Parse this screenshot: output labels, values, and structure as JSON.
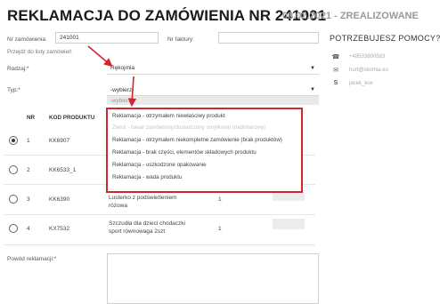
{
  "header": {
    "title": "REKLAMACJA DO ZAMÓWIENIA NR 241001",
    "meta": "08.02.2021 - ZREALIZOWANE"
  },
  "form": {
    "order_label": "Nr zamówienia:",
    "order_value": "241001",
    "invoice_label": "Nr faktury:",
    "back_link": "Przejdź do listy zamówień",
    "kind_label": "Rodzaj:*",
    "kind_value": "Rękojmia",
    "type_label": "Typ:*",
    "type_value": "-wybierz-",
    "reason_label": "Powód reklamacji:*"
  },
  "dropdown": {
    "placeholder": "-wybierz-",
    "options": [
      "Reklamacja - otrzymałem niewłaściwy produkt",
      "Zwrot - towar zamówiony/dostarczony omyłkowo (nadmiarowy)",
      "Reklamacja - otrzymałem niekompletne zamówienie (brak produktów)",
      "Reklamacja - brak części, elementów składowych produktu",
      "Reklamacja - uszkodzone opakowanie",
      "Reklamacja - wada produktu"
    ]
  },
  "table": {
    "headers": [
      "NR",
      "KOD PRODUKTU"
    ],
    "rows": [
      {
        "nr": "1",
        "code": "KK6907",
        "name": "",
        "qty": "",
        "selected": true
      },
      {
        "nr": "2",
        "code": "KK6533_1",
        "name": "",
        "qty": "",
        "selected": false
      },
      {
        "nr": "3",
        "code": "KK6390",
        "name": "różowa",
        "name_top": "Lusterko z podświetleniem",
        "qty": "1",
        "selected": false
      },
      {
        "nr": "4",
        "code": "KX7532",
        "name": "Szczudła dla dzieci chodaczki sport równowaga 2szt",
        "qty": "1",
        "selected": false
      }
    ]
  },
  "help": {
    "title": "POTRZEBUJESZ POMOCY?",
    "phone": "+48533800583",
    "email": "hurt@skomia.eu",
    "skype": "jacek_kox",
    "phone_icon": "phone-icon",
    "email_icon": "mail-icon",
    "skype_icon": "skype-icon"
  },
  "colors": {
    "highlight": "#d4252e"
  }
}
